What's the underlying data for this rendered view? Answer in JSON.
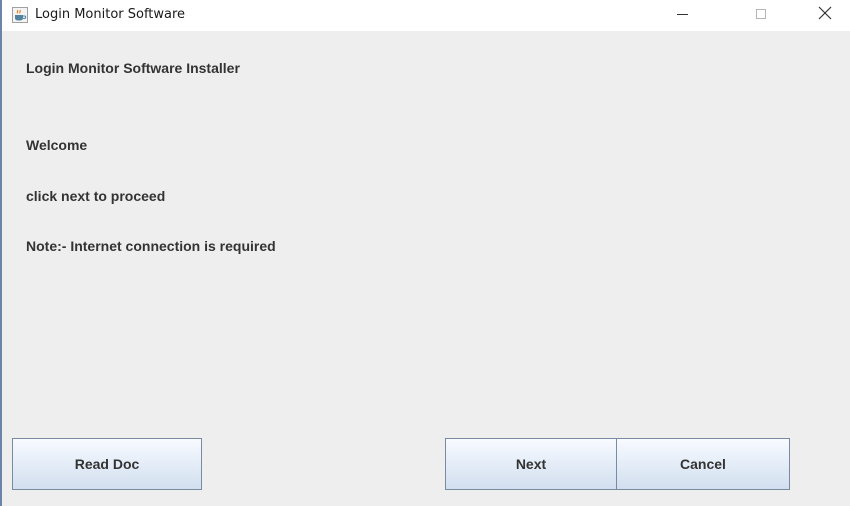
{
  "window": {
    "title": "Login Monitor Software",
    "app_icon": "java-coffee-cup-icon",
    "controls": {
      "minimize_icon": "minimize-icon",
      "maximize_icon": "maximize-icon",
      "close_icon": "close-icon"
    }
  },
  "content": {
    "heading": "Login Monitor Software Installer",
    "welcome": "Welcome",
    "instruction": "click next to proceed",
    "note": "Note:- Internet connection is required"
  },
  "buttons": {
    "read_doc": "Read Doc",
    "next": "Next",
    "cancel": "Cancel"
  },
  "colors": {
    "window_background": "#eeeeee",
    "titlebar_background": "#ffffff",
    "text": "#333333",
    "button_border": "#7a8aa0"
  }
}
